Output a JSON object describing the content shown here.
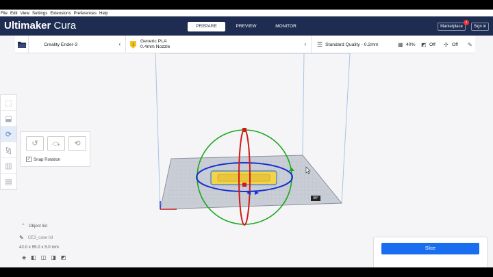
{
  "menu": [
    "File",
    "Edit",
    "View",
    "Settings",
    "Extensions",
    "Preferences",
    "Help"
  ],
  "header": {
    "brand_bold": "Ultimaker",
    "brand_thin": "Cura",
    "stages": [
      "PREPARE",
      "PREVIEW",
      "MONITOR"
    ],
    "active_stage": "PREPARE",
    "marketplace_label": "Marketplace",
    "marketplace_badge": "1",
    "signin_label": "Sign in"
  },
  "config": {
    "printer": "Creality Ender-3",
    "material": "Generic PLA",
    "nozzle": "0.4mm Nozzle",
    "quality": "Standard Quality - 0.2mm",
    "infill": "40%",
    "support": "Off",
    "adhesion": "Off"
  },
  "rotate": {
    "snap_label": "Snap Rotation",
    "snap_checked": true,
    "angle_tooltip": "90°"
  },
  "objects": {
    "header": "Object list",
    "name": "CE3_case lid",
    "dimensions": "42.0 x 95.0 x 5.0 mm"
  },
  "slice": {
    "label": "Slice"
  },
  "colors": {
    "topbar": "#1f2c51",
    "accent": "#196ef0",
    "rotate_x": "#d21919",
    "rotate_y": "#19a819",
    "rotate_z": "#1930d2"
  }
}
